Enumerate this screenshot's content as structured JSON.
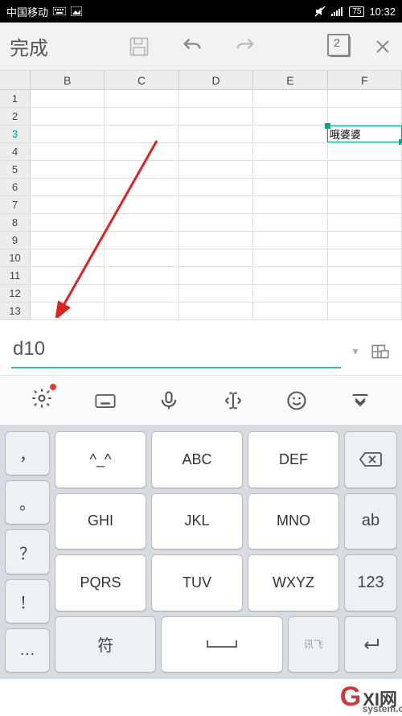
{
  "status": {
    "carrier": "中国移动",
    "battery": "75",
    "time": "10:32"
  },
  "toolbar": {
    "done": "完成",
    "sheet_count": "2"
  },
  "sheet": {
    "columns": [
      "B",
      "C",
      "D",
      "E",
      "F"
    ],
    "rows": [
      "1",
      "2",
      "3",
      "4",
      "5",
      "6",
      "7",
      "8",
      "9",
      "10",
      "11",
      "12",
      "13"
    ],
    "selected_row": "3",
    "cell_f3": "哦婆婆"
  },
  "formula": {
    "value": "d10"
  },
  "keyboard": {
    "left": [
      "，",
      "。",
      "？",
      "！",
      "…"
    ],
    "center": [
      [
        "^_^",
        "ABC",
        "DEF"
      ],
      [
        "GHI",
        "JKL",
        "MNO"
      ],
      [
        "PQRS",
        "TUV",
        "WXYZ"
      ]
    ],
    "right_ab": "ab",
    "right_123": "123",
    "bottom_fu": "符",
    "ime_hint": "讯飞"
  },
  "watermark": {
    "brand_g": "G",
    "brand_rest": "XI网",
    "domain": "system.com"
  }
}
